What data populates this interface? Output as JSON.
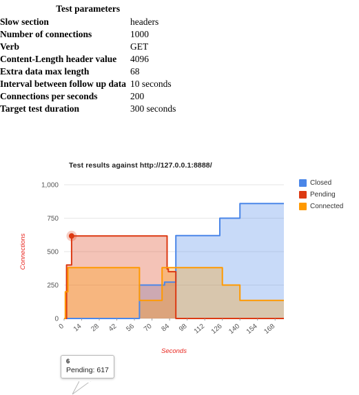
{
  "parameters": {
    "heading": "Test parameters",
    "rows": [
      {
        "label": "Slow section",
        "value": "headers"
      },
      {
        "label": "Number of connections",
        "value": "1000"
      },
      {
        "label": "Verb",
        "value": "GET"
      },
      {
        "label": "Content-Length header value",
        "value": "4096"
      },
      {
        "label": "Extra data max length",
        "value": "68"
      },
      {
        "label": "Interval between follow up data",
        "value": "10 seconds"
      },
      {
        "label": "Connections per seconds",
        "value": "200"
      },
      {
        "label": "Target test duration",
        "value": "300 seconds"
      }
    ]
  },
  "tooltip": {
    "title": "6",
    "body": "Pending: 617"
  },
  "legend": {
    "position": "right",
    "items": [
      {
        "label": "Closed",
        "color": "#4a86e8"
      },
      {
        "label": "Pending",
        "color": "#dc3912"
      },
      {
        "label": "Connected",
        "color": "#ff9900"
      }
    ]
  },
  "chart_data": {
    "type": "area",
    "title": "Test results against http://127.0.0.1:8888/",
    "xlabel": "Seconds",
    "ylabel": "Connections",
    "xlim": [
      0,
      175
    ],
    "ylim": [
      0,
      1000
    ],
    "grid": true,
    "xticks": [
      0,
      14,
      28,
      42,
      56,
      70,
      84,
      98,
      112,
      126,
      140,
      154,
      168
    ],
    "yticks": [
      0,
      250,
      500,
      750,
      1000
    ],
    "ytick_labels": [
      "0",
      "250",
      "500",
      "750",
      "1,000"
    ],
    "interpolation": "step",
    "series": [
      {
        "name": "Closed",
        "color": "#4a86e8",
        "x": [
          0,
          59,
          60,
          79,
          80,
          88,
          89,
          123,
          124,
          139,
          140,
          175
        ],
        "values": [
          0,
          0,
          250,
          250,
          272,
          272,
          620,
          620,
          750,
          750,
          860,
          860
        ]
      },
      {
        "name": "Pending",
        "color": "#dc3912",
        "x": [
          0,
          2,
          6,
          79,
          80,
          82,
          83,
          87,
          88,
          89,
          175
        ],
        "values": [
          0,
          400,
          617,
          617,
          617,
          370,
          350,
          350,
          350,
          0,
          0
        ]
      },
      {
        "name": "Connected",
        "color": "#ff9900",
        "x": [
          0,
          1,
          3,
          59,
          60,
          77,
          78,
          125,
          126,
          139,
          140,
          175
        ],
        "values": [
          0,
          200,
          380,
          380,
          135,
          135,
          380,
          380,
          250,
          250,
          135,
          135
        ]
      }
    ],
    "highlighted_point": {
      "series": "Pending",
      "x": 6,
      "y": 617
    }
  }
}
